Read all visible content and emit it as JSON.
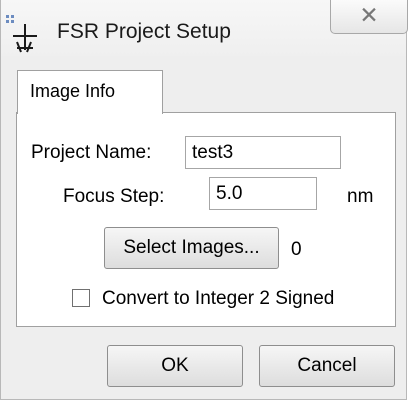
{
  "window": {
    "title": "FSR Project Setup",
    "close_glyph": "✕",
    "icon": "fsr-app-icon"
  },
  "tabs": [
    {
      "label": "Image Info",
      "selected": true
    }
  ],
  "form": {
    "project_name_label": "Project Name:",
    "project_name_value": "test3",
    "focus_step_label": "Focus Step:",
    "focus_step_value": "5.0",
    "focus_step_unit": "nm",
    "select_images_label": "Select Images...",
    "image_count": "0",
    "convert_label": "Convert to Integer 2 Signed",
    "convert_checked": false
  },
  "buttons": {
    "ok_label": "OK",
    "cancel_label": "Cancel"
  }
}
